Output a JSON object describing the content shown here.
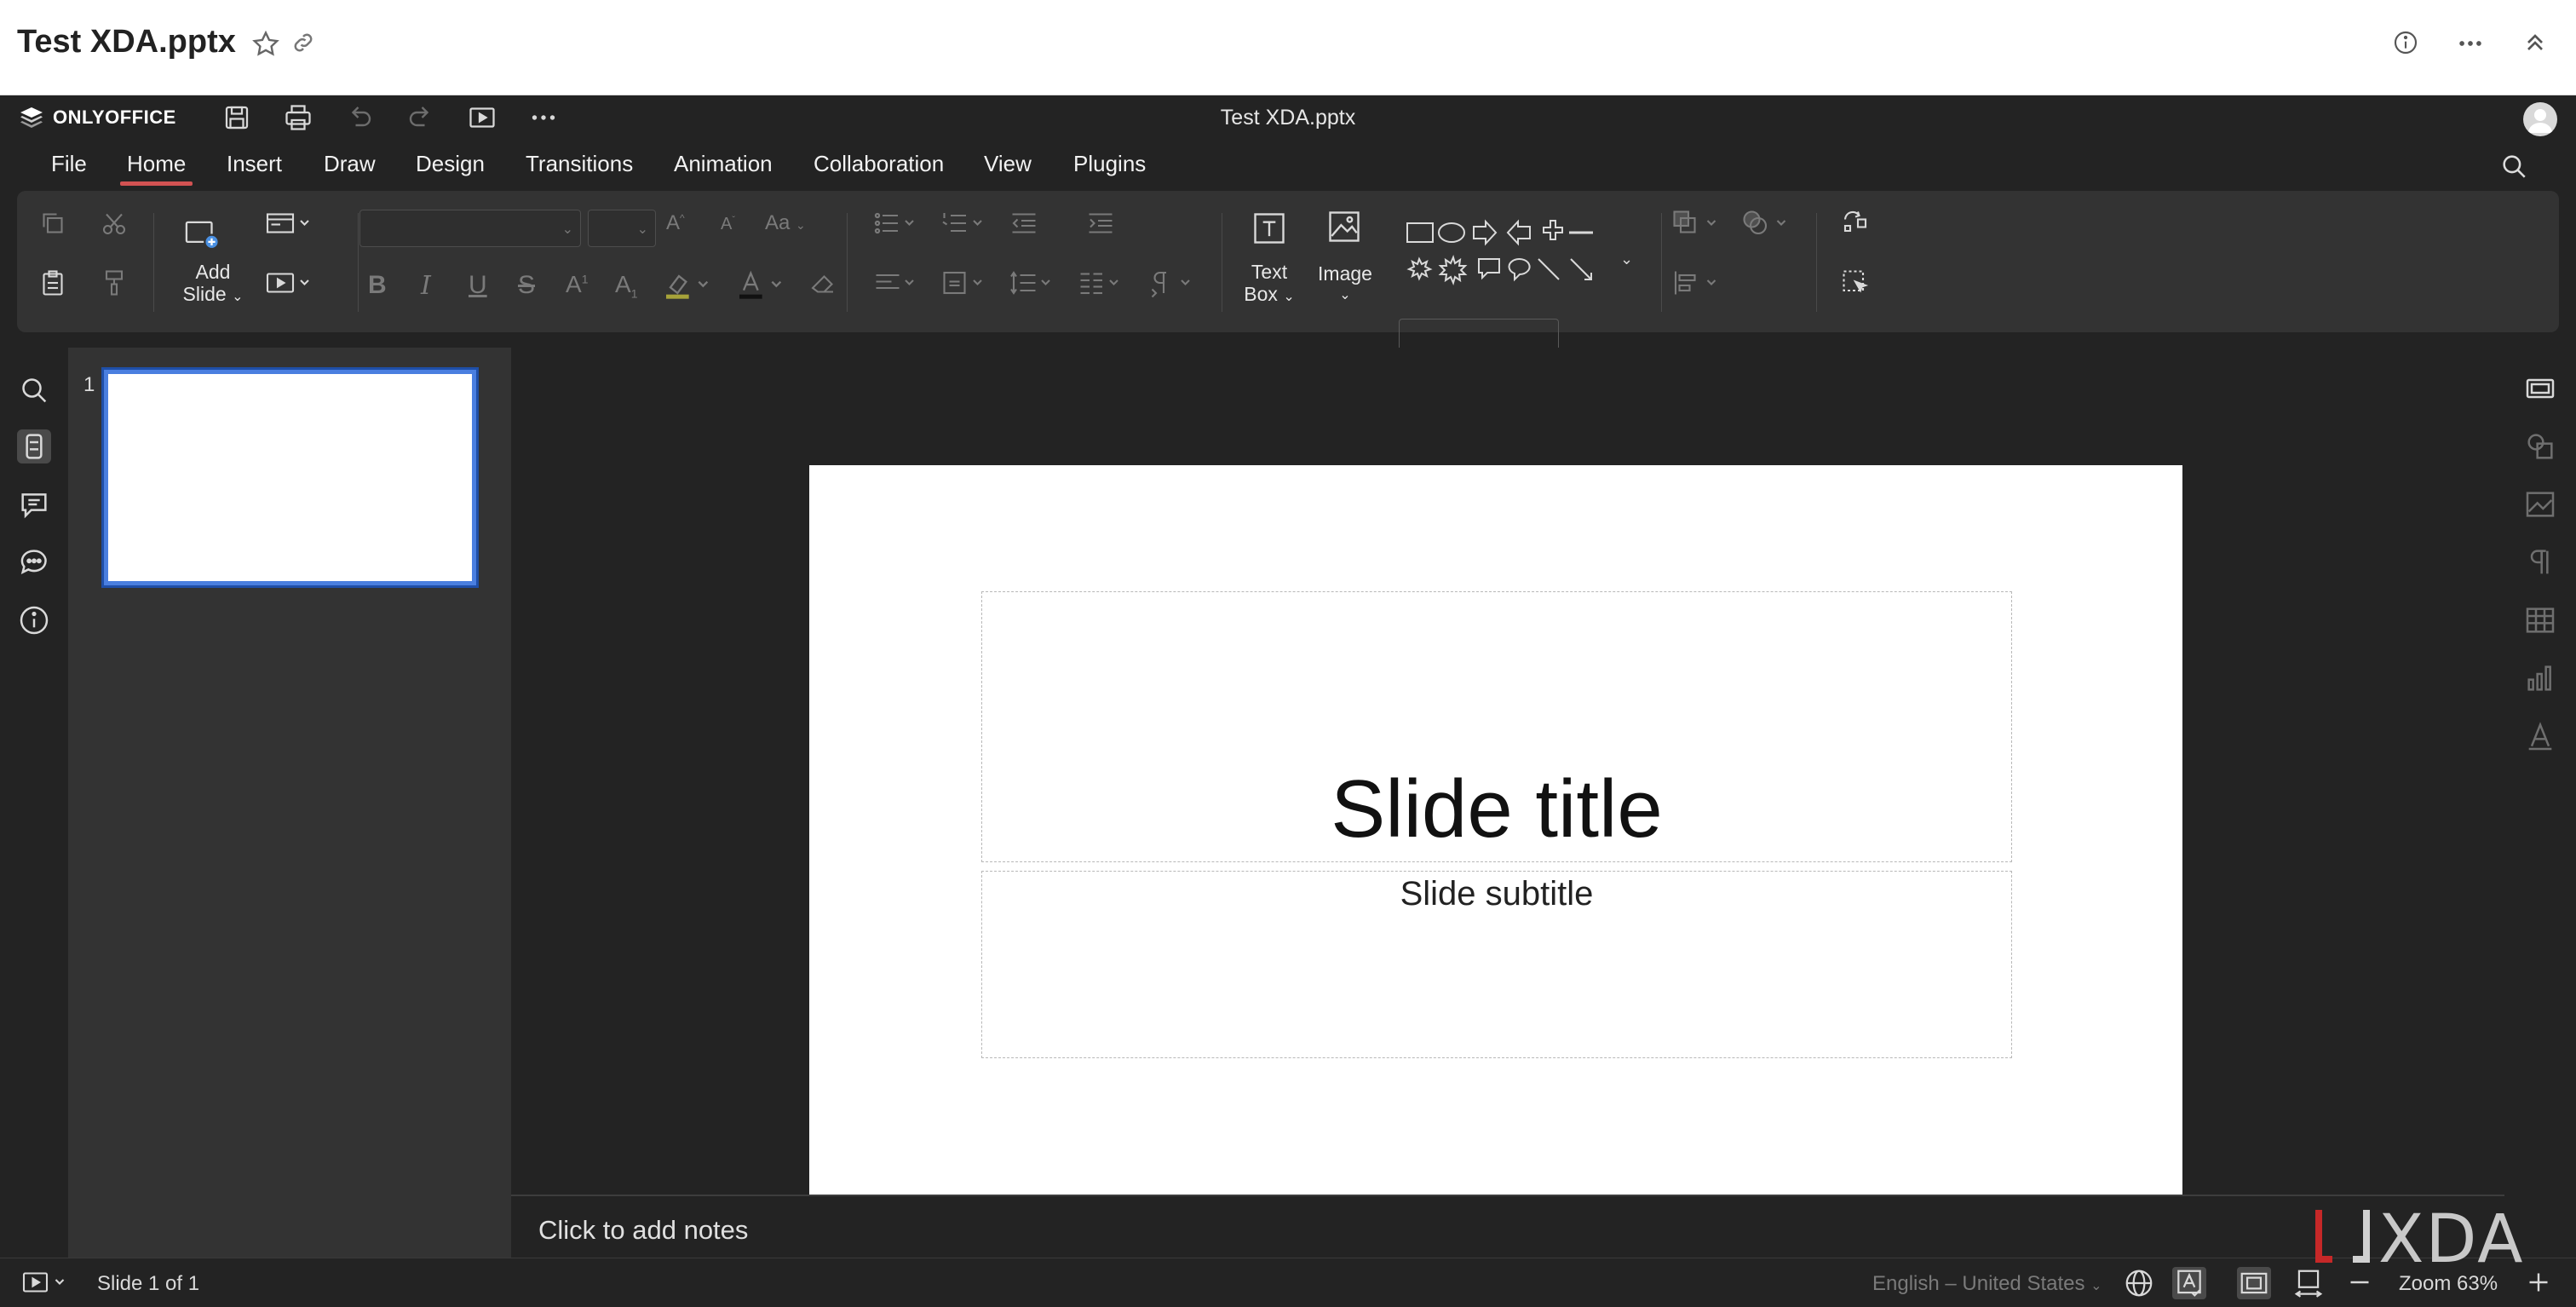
{
  "host": {
    "title": "Test XDA.pptx"
  },
  "app": {
    "logo_text": "ONLYOFFICE",
    "doc_title": "Test XDA.pptx"
  },
  "menu": {
    "tabs": [
      "File",
      "Home",
      "Insert",
      "Draw",
      "Design",
      "Transitions",
      "Animation",
      "Collaboration",
      "View",
      "Plugins"
    ],
    "active": "Home"
  },
  "ribbon": {
    "add_slide_line1": "Add",
    "add_slide_line2": "Slide",
    "text_box_line1": "Text",
    "text_box_line2": "Box",
    "image_label": "Image"
  },
  "thumbnails": {
    "slide_number": "1"
  },
  "slide": {
    "title": "Slide title",
    "subtitle": "Slide subtitle"
  },
  "notes": {
    "placeholder": "Click to add notes"
  },
  "status": {
    "slide_counter": "Slide 1 of 1",
    "language": "English – United States",
    "zoom": "Zoom 63%"
  },
  "watermark": {
    "text": "XDA"
  },
  "colors": {
    "accent_tab": "#d25252",
    "thumb_border": "#4a7fe0",
    "editor_bg": "#232323",
    "panel_bg": "#333333"
  }
}
